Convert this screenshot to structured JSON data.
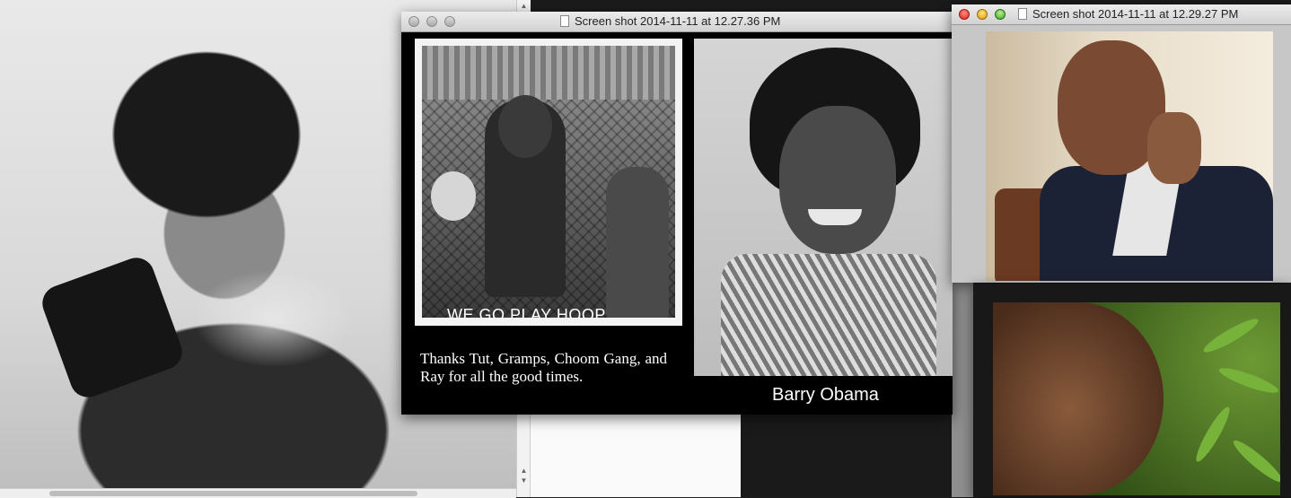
{
  "windows": [
    {
      "title": "Screen shot 2014-11-11 at 12.27.36 PM",
      "active": false
    },
    {
      "title": "Screen shot 2014-11-11 at 12.29.27 PM",
      "active": true
    }
  ],
  "yearbook": {
    "photo_caption": "WE GO PLAY HOOP",
    "quote": "Thanks Tut, Gramps, Choom Gang, and Ray for all the good times.",
    "name": "Barry Obama"
  },
  "colors": {
    "window_bg": "#000000",
    "titlebar": "#e0e0e0",
    "close": "#d9251c",
    "minimize": "#dd9a0e",
    "zoom": "#3ca22a"
  }
}
